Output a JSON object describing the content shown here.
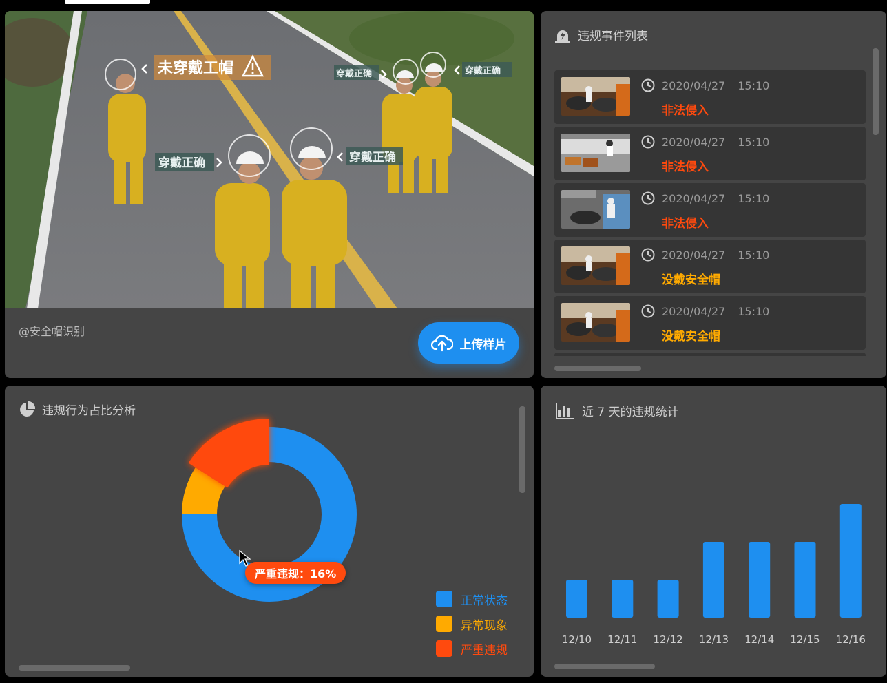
{
  "camera": {
    "overlays": {
      "no_helmet": "未穿戴工帽",
      "correct_1": "穿戴正确",
      "correct_2": "穿戴正确",
      "correct_3": "穿戴正确"
    },
    "source_label": "@安全帽识别",
    "upload_label": "上传样片"
  },
  "events": {
    "title": "违规事件列表",
    "items": [
      {
        "date": "2020/04/27",
        "time": "15:10",
        "type": "非法侵入",
        "color": "#ff4a0e"
      },
      {
        "date": "2020/04/27",
        "time": "15:10",
        "type": "非法侵入",
        "color": "#ff4a0e"
      },
      {
        "date": "2020/04/27",
        "time": "15:10",
        "type": "非法侵入",
        "color": "#ff4a0e"
      },
      {
        "date": "2020/04/27",
        "time": "15:10",
        "type": "没戴安全帽",
        "color": "#ffaa00"
      },
      {
        "date": "2020/04/27",
        "time": "15:10",
        "type": "没戴安全帽",
        "color": "#ffaa00"
      }
    ]
  },
  "pie": {
    "title": "违规行为占比分析",
    "tooltip": "严重违规：16%",
    "chart_data": {
      "type": "pie",
      "donut": true,
      "slices": [
        {
          "name": "正常状态",
          "value": 75,
          "color": "#1e8ff0"
        },
        {
          "name": "异常现象",
          "value": 9,
          "color": "#ffaa00"
        },
        {
          "name": "严重违规",
          "value": 16,
          "color": "#ff4a0e"
        }
      ],
      "highlighted": "严重违规",
      "legend": "bottom-right"
    }
  },
  "bars": {
    "title": "近 7 天的违规统计",
    "chart_data": {
      "type": "bar",
      "categories": [
        "12/10",
        "12/11",
        "12/12",
        "12/13",
        "12/14",
        "12/15",
        "12/16"
      ],
      "values": [
        1,
        1,
        1,
        2,
        2,
        2,
        3
      ],
      "color": "#1e8ff0",
      "ylim": [
        0,
        3.4
      ],
      "grid": false
    }
  }
}
